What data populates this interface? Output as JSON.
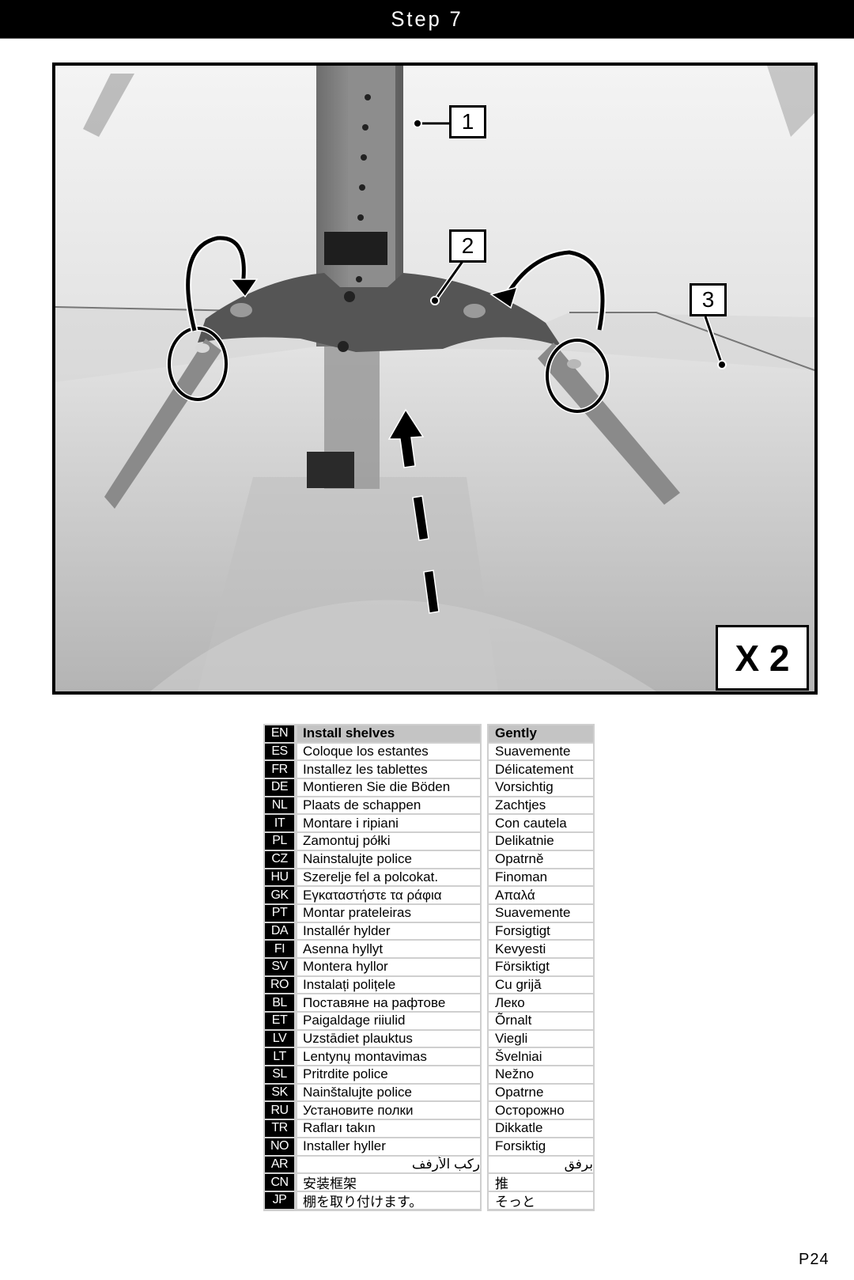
{
  "header": {
    "title": "Step 7"
  },
  "photo": {
    "callouts": [
      "1",
      "2",
      "3"
    ],
    "quantity_label": "X 2",
    "icons": [
      "curved-arrow-left",
      "curved-arrow-right",
      "circle-highlight-left",
      "circle-highlight-right",
      "dashed-up-arrow"
    ]
  },
  "instructions": {
    "rows": [
      {
        "code": "EN",
        "action": "Install shelves",
        "manner": "Gently"
      },
      {
        "code": "ES",
        "action": "Coloque los estantes",
        "manner": "Suavemente"
      },
      {
        "code": "FR",
        "action": "Installez les tablettes",
        "manner": "Délicatement"
      },
      {
        "code": "DE",
        "action": "Montieren Sie die Böden",
        "manner": "Vorsichtig"
      },
      {
        "code": "NL",
        "action": "Plaats de schappen",
        "manner": "Zachtjes"
      },
      {
        "code": "IT",
        "action": "Montare i ripiani",
        "manner": "Con cautela"
      },
      {
        "code": "PL",
        "action": "Zamontuj półki",
        "manner": "Delikatnie"
      },
      {
        "code": "CZ",
        "action": "Nainstalujte police",
        "manner": "Opatrně"
      },
      {
        "code": "HU",
        "action": "Szerelje fel a polcokat.",
        "manner": "Finoman"
      },
      {
        "code": "GK",
        "action": "Εγκαταστήστε τα ράφια",
        "manner": "Απαλά"
      },
      {
        "code": "PT",
        "action": "Montar prateleiras",
        "manner": "Suavemente"
      },
      {
        "code": "DA",
        "action": "Installér hylder",
        "manner": "Forsigtigt"
      },
      {
        "code": "FI",
        "action": "Asenna hyllyt",
        "manner": "Kevyesti"
      },
      {
        "code": "SV",
        "action": "Montera hyllor",
        "manner": "Försiktigt"
      },
      {
        "code": "RO",
        "action": "Instalați polițele",
        "manner": "Cu grijă"
      },
      {
        "code": "BL",
        "action": "Поставяне на рафтове",
        "manner": "Леко"
      },
      {
        "code": "ET",
        "action": "Paigaldage riiulid",
        "manner": "Õrnalt"
      },
      {
        "code": "LV",
        "action": "Uzstādiet plauktus",
        "manner": "Viegli"
      },
      {
        "code": "LT",
        "action": "Lentynų montavimas",
        "manner": "Švelniai"
      },
      {
        "code": "SL",
        "action": "Pritrdite police",
        "manner": "Nežno"
      },
      {
        "code": "SK",
        "action": "Nainštalujte police",
        "manner": "Opatrne"
      },
      {
        "code": "RU",
        "action": "Установите полки",
        "manner": "Осторожно"
      },
      {
        "code": "TR",
        "action": "Rafları takın",
        "manner": "Dikkatle"
      },
      {
        "code": "NO",
        "action": "Installer hyller",
        "manner": "Forsiktig"
      },
      {
        "code": "AR",
        "action": "ركب الأرفف",
        "manner": "برفق"
      },
      {
        "code": "CN",
        "action": "安装框架",
        "manner": "推"
      },
      {
        "code": "JP",
        "action": "棚を取り付けます。",
        "manner": "そっと"
      }
    ]
  },
  "footer": {
    "page": "P24"
  }
}
